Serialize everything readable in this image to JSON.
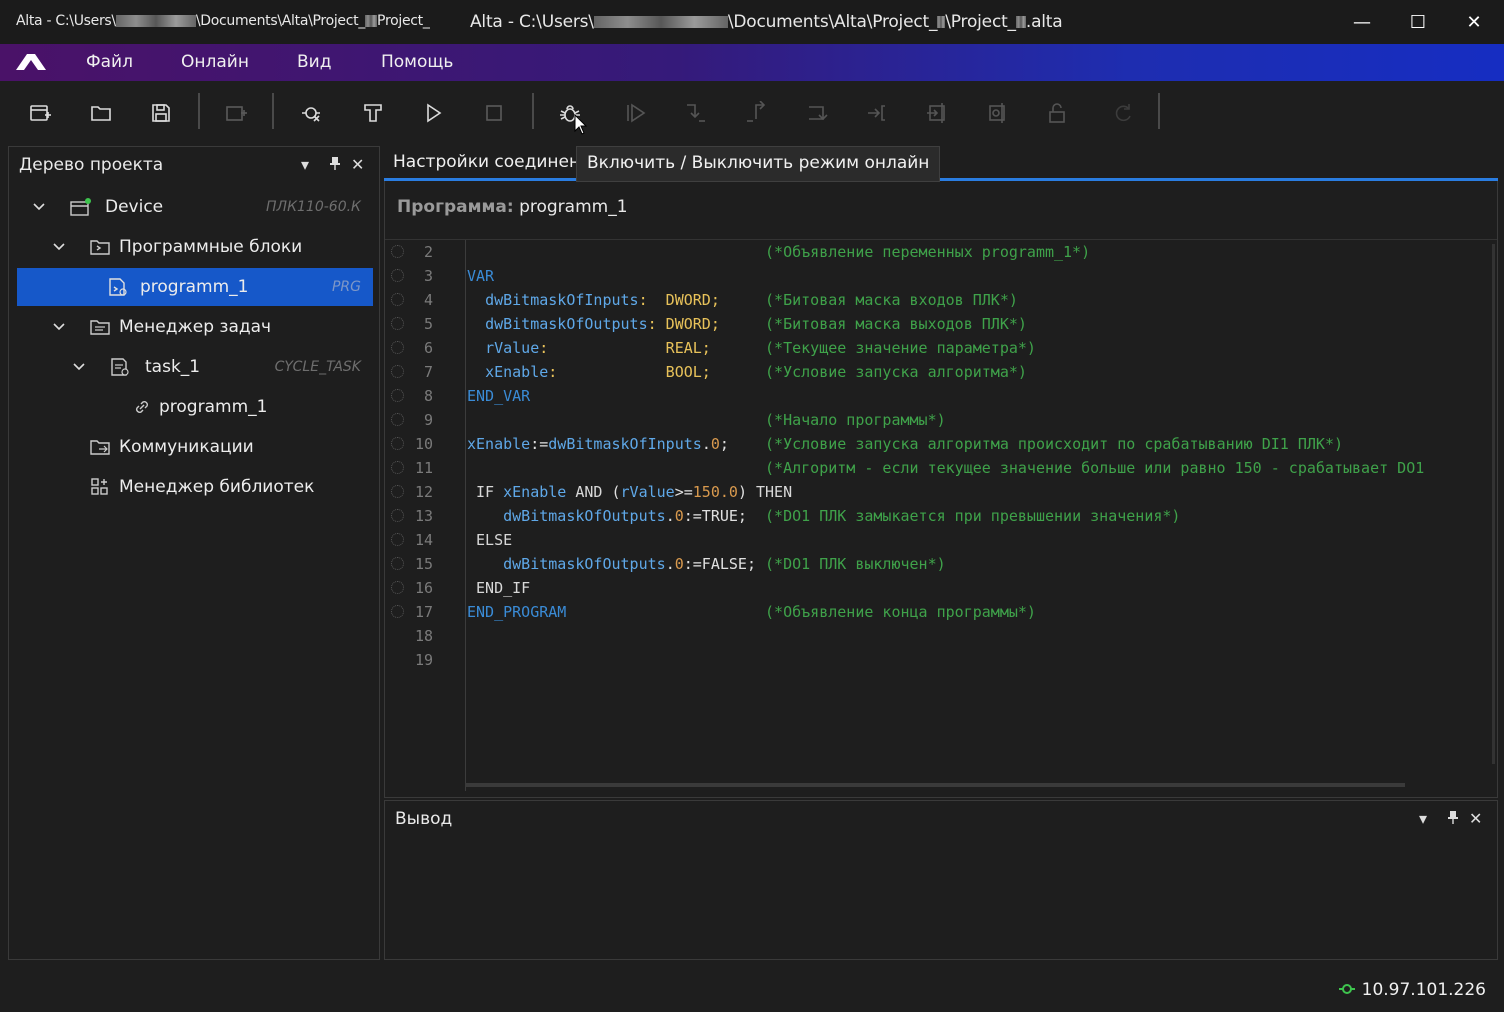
{
  "window": {
    "title_small_prefix": "Alta - C:\\Users\\",
    "title_small_mid": "\\Documents\\Alta\\Project_",
    "title_small_end": "Project_",
    "title_big_prefix": "Alta - C:\\Users\\",
    "title_big_mid": "\\Documents\\Alta\\Project_",
    "title_big_mid2": "\\Project_",
    "title_big_end": ".alta",
    "minimize": "—",
    "maximize": "☐",
    "close": "✕"
  },
  "menu": {
    "items": [
      "Файл",
      "Онлайн",
      "Вид",
      "Помощь"
    ]
  },
  "toolbar": {
    "icons": [
      "new-project-icon",
      "open-folder-icon",
      "save-icon",
      "add-device-icon",
      "compile-icon",
      "build-icon",
      "run-icon",
      "stop-icon",
      "debug-online-icon",
      "step-run-icon",
      "step-over-icon",
      "step-into-icon",
      "step-out-icon",
      "run-to-cursor-icon",
      "upload-icon",
      "download-icon",
      "unlock-icon",
      "reset-icon"
    ]
  },
  "project_tree": {
    "title": "Дерево проекта",
    "items": [
      {
        "label": "Device",
        "type": "ПЛК110-60.К"
      },
      {
        "label": "Программные блоки",
        "type": ""
      },
      {
        "label": "programm_1",
        "type": "PRG"
      },
      {
        "label": "Менеджер задач",
        "type": ""
      },
      {
        "label": "task_1",
        "type": "CYCLE_TASK"
      },
      {
        "label": "programm_1",
        "type": ""
      },
      {
        "label": "Коммуникации",
        "type": ""
      },
      {
        "label": "Менеджер библиотек",
        "type": ""
      }
    ]
  },
  "editor": {
    "tab_label": "Настройки соединения",
    "tooltip": "Включить / Выключить режим онлайн",
    "program_label": "Программа:",
    "program_name": "programm_1",
    "line_numbers": [
      "2",
      "3",
      "4",
      "5",
      "6",
      "7",
      "8",
      "9",
      "10",
      "11",
      "12",
      "13",
      "14",
      "15",
      "16",
      "17",
      "18",
      "19"
    ]
  },
  "output": {
    "title": "Вывод"
  },
  "status": {
    "ip": "10.97.101.226"
  },
  "colors": {
    "accent": "#2a7de1",
    "selection": "#1658c9",
    "comment": "#3fa24a",
    "keyword": "#3a8bd6",
    "type": "#e8c25a"
  }
}
